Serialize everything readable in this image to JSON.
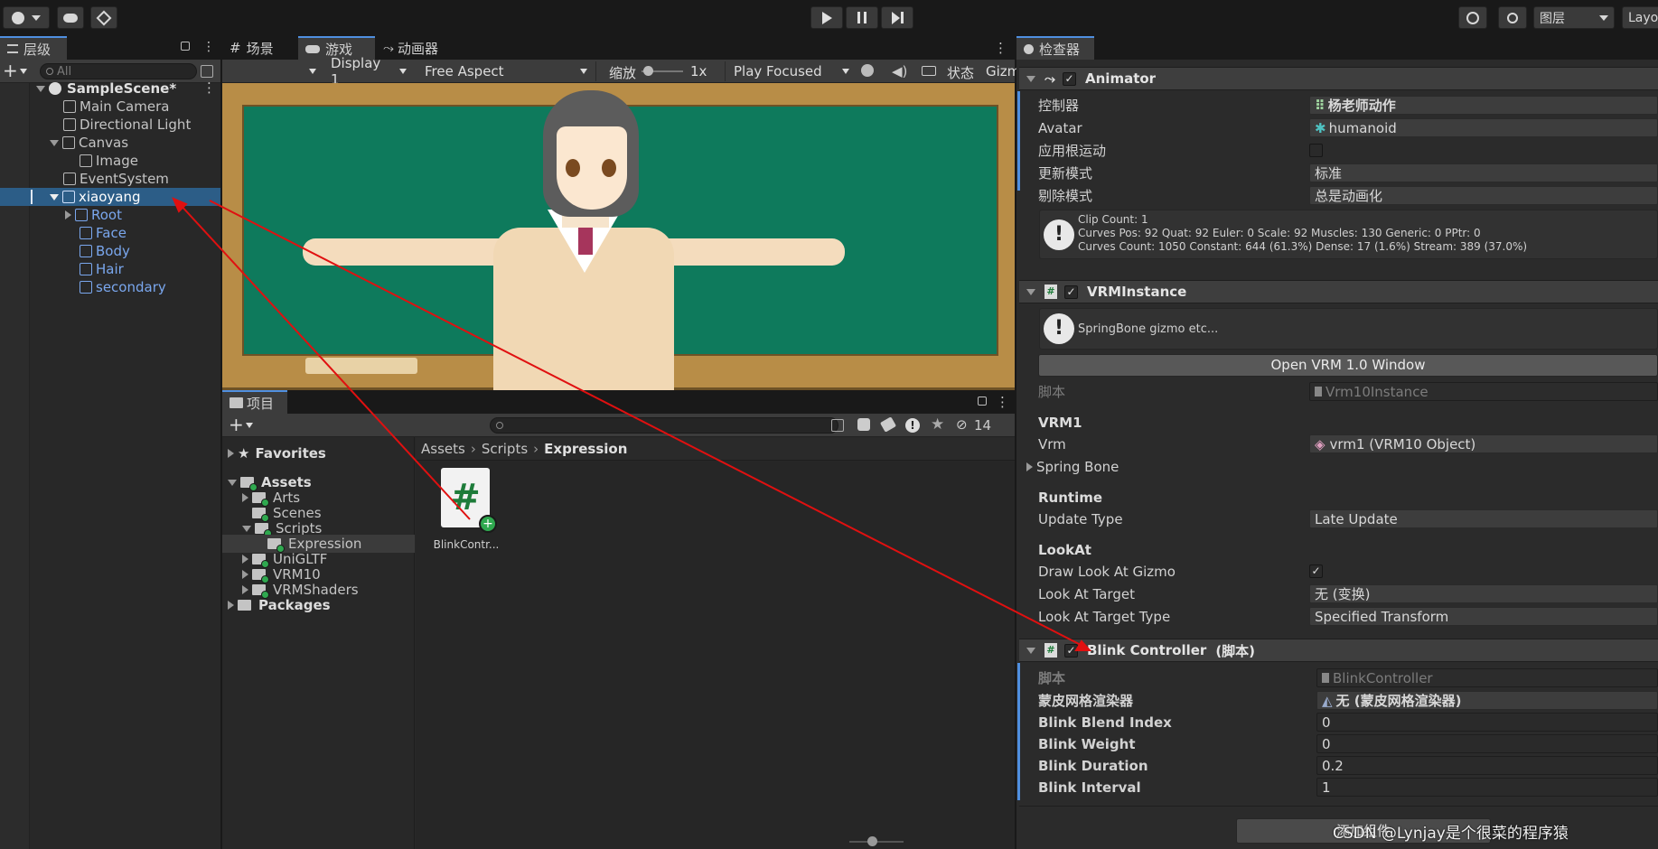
{
  "toolbar": {
    "account_icon": "account-icon",
    "cloud_icon": "cloud-icon",
    "collab_icon": "collab-icon",
    "play_icon": "play-icon",
    "pause_icon": "pause-icon",
    "step_icon": "step-icon",
    "history_icon": "history-icon",
    "search_icon": "search-icon",
    "layers_label": "图层",
    "layout_label": "Layo"
  },
  "hierarchy": {
    "tab": "层级",
    "search_placeholder": "All",
    "scene": "SampleScene*",
    "items": [
      {
        "label": "Main Camera"
      },
      {
        "label": "Directional Light"
      },
      {
        "label": "Canvas"
      },
      {
        "label": "Image"
      },
      {
        "label": "EventSystem"
      },
      {
        "label": "xiaoyang"
      },
      {
        "label": "Root"
      },
      {
        "label": "Face"
      },
      {
        "label": "Body"
      },
      {
        "label": "Hair"
      },
      {
        "label": "secondary"
      }
    ]
  },
  "game": {
    "tabs": [
      "场景",
      "游戏",
      "动画器"
    ],
    "display": "Display 1",
    "aspect": "Free Aspect",
    "scale_label": "缩放",
    "scale_value": "1x",
    "play_focused": "Play Focused",
    "stats": "状态",
    "gizmos": "Gizm"
  },
  "project": {
    "tab": "项目",
    "hidden_count": "14",
    "favorites": "Favorites",
    "assets": "Assets",
    "tree": [
      "Arts",
      "Scenes",
      "Scripts",
      "Expression",
      "UniGLTF",
      "VRM10",
      "VRMShaders"
    ],
    "packages": "Packages",
    "breadcrumb": [
      "Assets",
      "Scripts",
      "Expression"
    ],
    "file_name": "BlinkContr..."
  },
  "inspector": {
    "tab": "检查器",
    "animator": {
      "title": "Animator",
      "rows": [
        {
          "label": "控制器",
          "value": "杨老师动作"
        },
        {
          "label": "Avatar",
          "value": "humanoid"
        },
        {
          "label": "应用根运动",
          "value": ""
        },
        {
          "label": "更新模式",
          "value": "标准"
        },
        {
          "label": "剔除模式",
          "value": "总是动画化"
        }
      ],
      "info_lines": [
        "Clip Count: 1",
        "Curves Pos: 92 Quat: 92 Euler: 0 Scale: 92 Muscles: 130 Generic: 0 PPtr: 0",
        "Curves Count: 1050 Constant: 644 (61.3%) Dense: 17 (1.6%) Stream: 389 (37.0%)"
      ]
    },
    "vrm": {
      "title": "VRMInstance",
      "note": "SpringBone gizmo etc...",
      "button": "Open VRM 1.0 Window",
      "script_label": "脚本",
      "script_value": "Vrm10Instance",
      "section_vrm1": "VRM1",
      "vrm_label": "Vrm",
      "vrm_value": "vrm1  (VRM10 Object)",
      "spring_bone": "Spring Bone",
      "section_runtime": "Runtime",
      "update_type_label": "Update Type",
      "update_type_value": "Late Update",
      "section_lookat": "LookAt",
      "draw_gizmo_label": "Draw Look At Gizmo",
      "look_target_label": "Look At Target",
      "look_target_value": "无 (变换)",
      "look_type_label": "Look At Target Type",
      "look_type_value": "Specified Transform"
    },
    "blink": {
      "title": "Blink Controller",
      "title_suffix": "(脚本)",
      "script_label": "脚本",
      "script_value": "BlinkController",
      "renderer_label": "蒙皮网格渲染器",
      "renderer_value": "无 (蒙皮网格渲染器)",
      "rows": [
        {
          "label": "Blink Blend Index",
          "value": "0"
        },
        {
          "label": "Blink Weight",
          "value": "0"
        },
        {
          "label": "Blink Duration",
          "value": "0.2"
        },
        {
          "label": "Blink Interval",
          "value": "1"
        }
      ]
    },
    "add_component": "添加组件"
  },
  "watermark": "CSDN @Lynjay是个很菜的程序猿",
  "colors": {
    "accent": "#4f8fe0",
    "selection": "#2c5d87",
    "arrow": "#e01010",
    "chalkboard": "#0e7a5c",
    "frame": "#b88d47"
  }
}
